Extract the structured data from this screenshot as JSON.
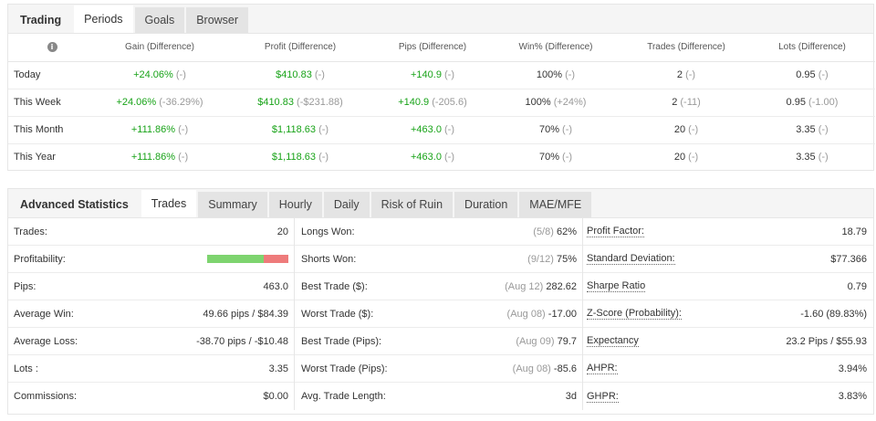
{
  "top_tabs": [
    "Trading",
    "Periods",
    "Goals",
    "Browser"
  ],
  "periods": {
    "headers": [
      "Gain (Difference)",
      "Profit (Difference)",
      "Pips (Difference)",
      "Win% (Difference)",
      "Trades (Difference)",
      "Lots (Difference)"
    ],
    "rows": [
      {
        "label": "Today",
        "gain": "+24.06%",
        "gain_diff": "(-)",
        "profit": "$410.83",
        "profit_diff": "(-)",
        "pips": "+140.9",
        "pips_diff": "(-)",
        "win": "100%",
        "win_diff": "(-)",
        "trades": "2",
        "trades_diff": "(-)",
        "lots": "0.95",
        "lots_diff": "(-)"
      },
      {
        "label": "This Week",
        "gain": "+24.06%",
        "gain_diff": "(-36.29%)",
        "profit": "$410.83",
        "profit_diff": "(-$231.88)",
        "pips": "+140.9",
        "pips_diff": "(-205.6)",
        "win": "100%",
        "win_diff": "(+24%)",
        "trades": "2",
        "trades_diff": "(-11)",
        "lots": "0.95",
        "lots_diff": "(-1.00)"
      },
      {
        "label": "This Month",
        "gain": "+111.86%",
        "gain_diff": "(-)",
        "profit": "$1,118.63",
        "profit_diff": "(-)",
        "pips": "+463.0",
        "pips_diff": "(-)",
        "win": "70%",
        "win_diff": "(-)",
        "trades": "20",
        "trades_diff": "(-)",
        "lots": "3.35",
        "lots_diff": "(-)"
      },
      {
        "label": "This Year",
        "gain": "+111.86%",
        "gain_diff": "(-)",
        "profit": "$1,118.63",
        "profit_diff": "(-)",
        "pips": "+463.0",
        "pips_diff": "(-)",
        "win": "70%",
        "win_diff": "(-)",
        "trades": "20",
        "trades_diff": "(-)",
        "lots": "3.35",
        "lots_diff": "(-)"
      }
    ]
  },
  "stats_tabs": [
    "Advanced Statistics",
    "Trades",
    "Summary",
    "Hourly",
    "Daily",
    "Risk of Ruin",
    "Duration",
    "MAE/MFE"
  ],
  "stats": {
    "col1": [
      {
        "label": "Trades:",
        "value": "20"
      },
      {
        "label": "Profitability:",
        "value": ""
      },
      {
        "label": "Pips:",
        "value": "463.0"
      },
      {
        "label": "Average Win:",
        "value": "49.66 pips / $84.39"
      },
      {
        "label": "Average Loss:",
        "value": "-38.70 pips / -$10.48"
      },
      {
        "label": "Lots :",
        "value": "3.35"
      },
      {
        "label": "Commissions:",
        "value": "$0.00"
      }
    ],
    "col2": [
      {
        "label": "Longs Won:",
        "muted": "(5/8)",
        "value": "62%"
      },
      {
        "label": "Shorts Won:",
        "muted": "(9/12)",
        "value": "75%"
      },
      {
        "label": "Best Trade ($):",
        "muted": "(Aug 12)",
        "value": "282.62"
      },
      {
        "label": "Worst Trade ($):",
        "muted": "(Aug 08)",
        "value": "-17.00"
      },
      {
        "label": "Best Trade (Pips):",
        "muted": "(Aug 09)",
        "value": "79.7"
      },
      {
        "label": "Worst Trade (Pips):",
        "muted": "(Aug 08)",
        "value": "-85.6"
      },
      {
        "label": "Avg. Trade Length:",
        "muted": "",
        "value": "3d"
      }
    ],
    "col3": [
      {
        "label": "Profit Factor:",
        "value": "18.79"
      },
      {
        "label": "Standard Deviation:",
        "value": "$77.366"
      },
      {
        "label": "Sharpe Ratio",
        "value": "0.79"
      },
      {
        "label": "Z-Score (Probability):",
        "value": "-1.60 (89.83%)"
      },
      {
        "label": "Expectancy",
        "value": "23.2 Pips / $55.93"
      },
      {
        "label": "AHPR:",
        "value": "3.94%"
      },
      {
        "label": "GHPR:",
        "value": "3.83%"
      }
    ]
  },
  "profitability": {
    "win_fraction": 0.7,
    "win_color": "#7ed46f",
    "loss_color": "#ee7b7b"
  },
  "colors": {
    "positive": "#18a318",
    "muted": "#999999"
  }
}
